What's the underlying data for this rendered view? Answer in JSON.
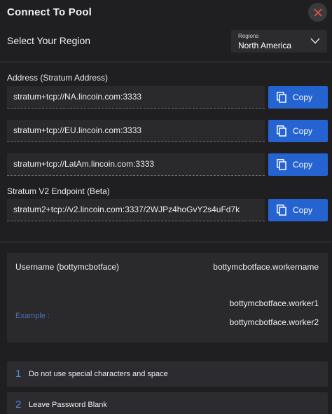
{
  "header": {
    "title": "Connect To Pool"
  },
  "region": {
    "label": "Select Your Region",
    "select_caption": "Regions",
    "selected": "North America"
  },
  "address_section": {
    "label": "Address (Stratum Address)"
  },
  "addresses": [
    {
      "value": "stratum+tcp://NA.lincoin.com:3333",
      "copy_label": "Copy"
    },
    {
      "value": "stratum+tcp://EU.lincoin.com:3333",
      "copy_label": "Copy"
    },
    {
      "value": "stratum+tcp://LatAm.lincoin.com:3333",
      "copy_label": "Copy"
    }
  ],
  "v2_section": {
    "label": "Stratum V2 Endpoint (Beta)",
    "value": "stratum2+tcp://v2.lincoin.com:3337/2WJPz4hoGvY2s4uFd7k",
    "copy_label": "Copy"
  },
  "username": {
    "label": "Username (bottymcbotface)",
    "value": "bottymcbotface.workername",
    "example_label": "Example :",
    "examples": [
      "bottymcbotface.worker1",
      "bottymcbotface.worker2"
    ]
  },
  "tips": [
    {
      "number": "1",
      "text": "Do not use special characters and space"
    },
    {
      "number": "2",
      "text": "Leave Password Blank"
    }
  ],
  "colors": {
    "background": "#1f1f21",
    "panel": "#2a2a2d",
    "accent_button": "#2563d1",
    "close_icon": "#e0514b",
    "example_label": "#4a6fb8"
  }
}
